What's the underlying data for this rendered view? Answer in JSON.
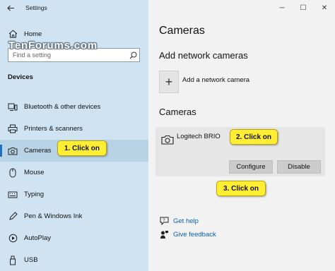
{
  "window": {
    "title": "Settings",
    "minimize": "─",
    "maximize": "☐",
    "close": "✕"
  },
  "watermark": "TenForums.com",
  "sidebar": {
    "home_label": "Home",
    "search_placeholder": "Find a setting",
    "section_title": "Devices",
    "items": [
      {
        "label": "Bluetooth & other devices",
        "icon": "bluetooth-devices-icon"
      },
      {
        "label": "Printers & scanners",
        "icon": "printer-icon"
      },
      {
        "label": "Cameras",
        "icon": "camera-icon",
        "selected": true
      },
      {
        "label": "Mouse",
        "icon": "mouse-icon"
      },
      {
        "label": "Typing",
        "icon": "keyboard-icon"
      },
      {
        "label": "Pen & Windows Ink",
        "icon": "pen-icon"
      },
      {
        "label": "AutoPlay",
        "icon": "autoplay-icon"
      },
      {
        "label": "USB",
        "icon": "usb-icon"
      }
    ]
  },
  "main": {
    "title": "Cameras",
    "add_network_heading": "Add network cameras",
    "add_network_label": "Add a network camera",
    "add_symbol": "+",
    "cameras_heading": "Cameras",
    "camera_name": "Logitech BRIO",
    "configure_label": "Configure",
    "disable_label": "Disable",
    "get_help": "Get help",
    "give_feedback": "Give feedback"
  },
  "callouts": {
    "step1": "1. Click on",
    "step2": "2. Click on",
    "step3": "3. Click on"
  },
  "colors": {
    "sidebar_bg": "#cfe3f2",
    "selected_bg": "#b8d3e6",
    "accent": "#1f6fbf",
    "link": "#0a5fb4",
    "callout": "#ffee33"
  }
}
